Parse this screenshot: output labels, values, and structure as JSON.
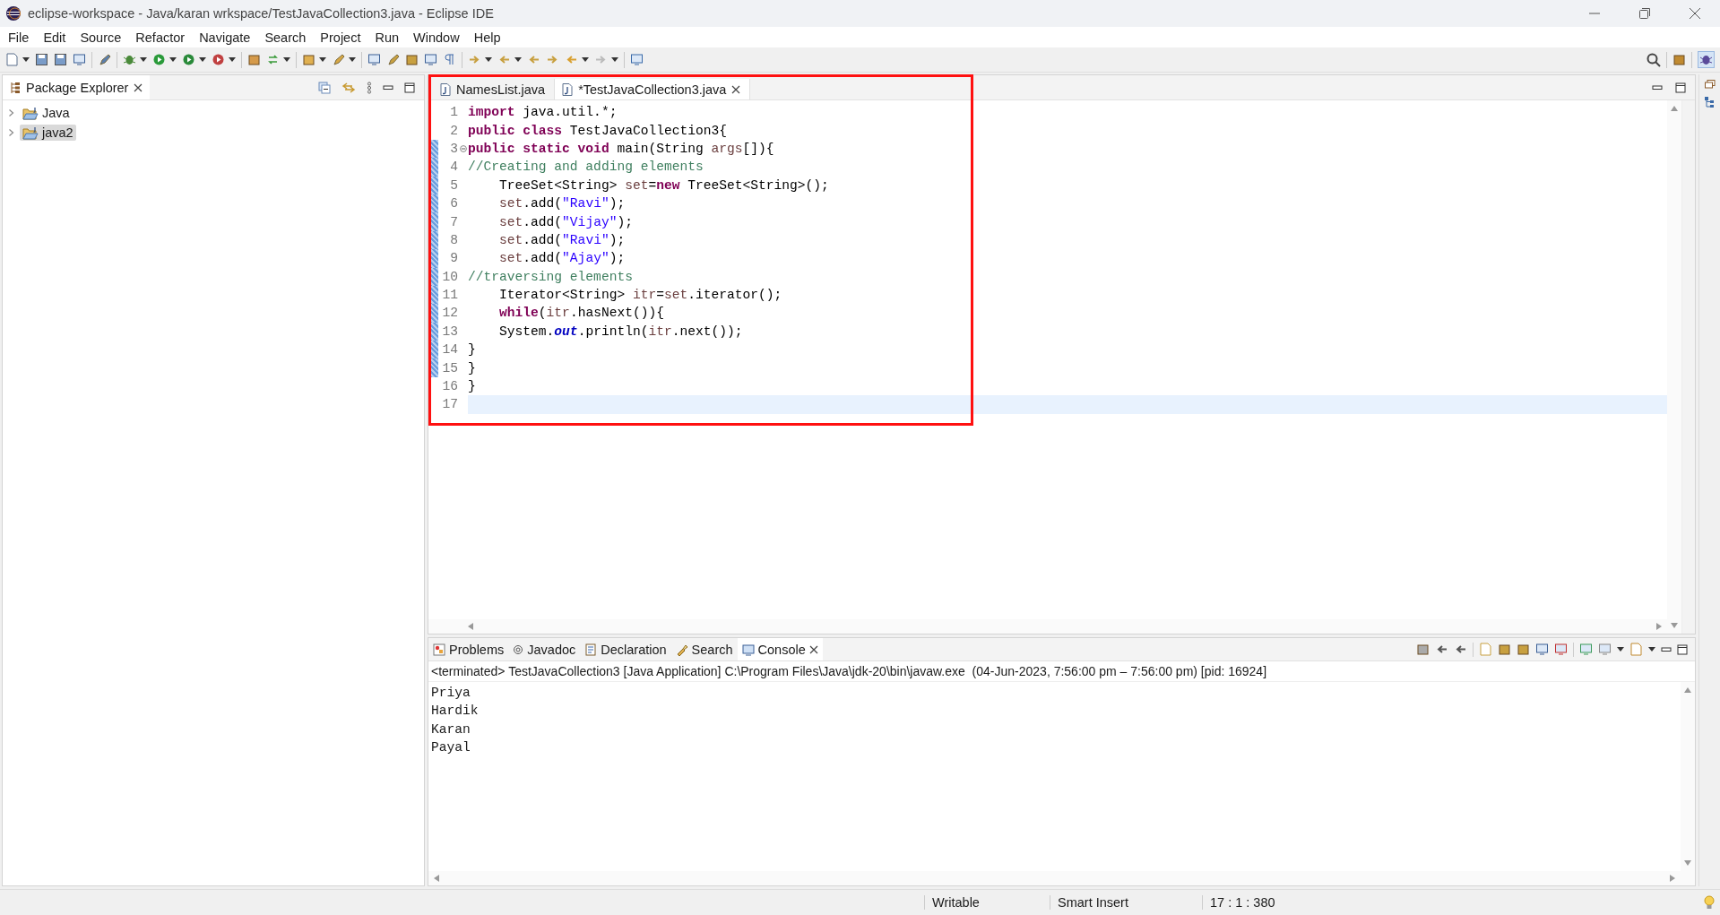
{
  "window": {
    "title": "eclipse-workspace - Java/karan wrkspace/TestJavaCollection3.java - Eclipse IDE"
  },
  "menu": [
    "File",
    "Edit",
    "Source",
    "Refactor",
    "Navigate",
    "Search",
    "Project",
    "Run",
    "Window",
    "Help"
  ],
  "package_explorer": {
    "title": "Package Explorer",
    "projects": [
      {
        "label": "Java",
        "selected": false,
        "expanded": false
      },
      {
        "label": "java2",
        "selected": true,
        "expanded": false
      }
    ]
  },
  "editor": {
    "tabs": [
      {
        "label": "NamesList.java",
        "selected": false
      },
      {
        "label": "*TestJavaCollection3.java",
        "selected": true
      }
    ],
    "lines": [
      {
        "number": "1",
        "changed": false,
        "current": false,
        "foldable": false,
        "segments": [
          {
            "kind": "keyword",
            "text": "import"
          },
          {
            "kind": "plain",
            "text": " java.util.*;"
          }
        ]
      },
      {
        "number": "2",
        "changed": false,
        "current": false,
        "foldable": false,
        "segments": [
          {
            "kind": "keyword",
            "text": "public class"
          },
          {
            "kind": "plain",
            "text": " TestJavaCollection3{"
          }
        ]
      },
      {
        "number": "3",
        "changed": true,
        "current": false,
        "foldable": true,
        "segments": [
          {
            "kind": "keyword",
            "text": "public static void"
          },
          {
            "kind": "plain",
            "text": " main(String "
          },
          {
            "kind": "variable",
            "text": "args"
          },
          {
            "kind": "plain",
            "text": "[]){"
          }
        ]
      },
      {
        "number": "4",
        "changed": true,
        "current": false,
        "foldable": false,
        "segments": [
          {
            "kind": "comment",
            "text": "//Creating and adding elements"
          }
        ]
      },
      {
        "number": "5",
        "changed": true,
        "current": false,
        "foldable": false,
        "segments": [
          {
            "kind": "plain",
            "text": "    TreeSet<String> "
          },
          {
            "kind": "variable",
            "text": "set"
          },
          {
            "kind": "plain",
            "text": "="
          },
          {
            "kind": "keyword",
            "text": "new"
          },
          {
            "kind": "plain",
            "text": " TreeSet<String>();"
          }
        ]
      },
      {
        "number": "6",
        "changed": true,
        "current": false,
        "foldable": false,
        "segments": [
          {
            "kind": "variable",
            "text": "    set"
          },
          {
            "kind": "plain",
            "text": ".add("
          },
          {
            "kind": "string",
            "text": "\"Ravi\""
          },
          {
            "kind": "plain",
            "text": ");"
          }
        ]
      },
      {
        "number": "7",
        "changed": true,
        "current": false,
        "foldable": false,
        "segments": [
          {
            "kind": "variable",
            "text": "    set"
          },
          {
            "kind": "plain",
            "text": ".add("
          },
          {
            "kind": "string",
            "text": "\"Vijay\""
          },
          {
            "kind": "plain",
            "text": ");"
          }
        ]
      },
      {
        "number": "8",
        "changed": true,
        "current": false,
        "foldable": false,
        "segments": [
          {
            "kind": "variable",
            "text": "    set"
          },
          {
            "kind": "plain",
            "text": ".add("
          },
          {
            "kind": "string",
            "text": "\"Ravi\""
          },
          {
            "kind": "plain",
            "text": ");"
          }
        ]
      },
      {
        "number": "9",
        "changed": true,
        "current": false,
        "foldable": false,
        "segments": [
          {
            "kind": "variable",
            "text": "    set"
          },
          {
            "kind": "plain",
            "text": ".add("
          },
          {
            "kind": "string",
            "text": "\"Ajay\""
          },
          {
            "kind": "plain",
            "text": ");"
          }
        ]
      },
      {
        "number": "10",
        "changed": true,
        "current": false,
        "foldable": false,
        "segments": [
          {
            "kind": "comment",
            "text": "//traversing elements"
          }
        ]
      },
      {
        "number": "11",
        "changed": true,
        "current": false,
        "foldable": false,
        "segments": [
          {
            "kind": "plain",
            "text": "    Iterator<String> "
          },
          {
            "kind": "variable",
            "text": "itr"
          },
          {
            "kind": "plain",
            "text": "="
          },
          {
            "kind": "variable",
            "text": "set"
          },
          {
            "kind": "plain",
            "text": ".iterator();"
          }
        ]
      },
      {
        "number": "12",
        "changed": true,
        "current": false,
        "foldable": false,
        "segments": [
          {
            "kind": "keyword",
            "text": "    while"
          },
          {
            "kind": "plain",
            "text": "("
          },
          {
            "kind": "variable",
            "text": "itr"
          },
          {
            "kind": "plain",
            "text": ".hasNext()){"
          }
        ]
      },
      {
        "number": "13",
        "changed": true,
        "current": false,
        "foldable": false,
        "segments": [
          {
            "kind": "plain",
            "text": "    System."
          },
          {
            "kind": "field",
            "text": "out"
          },
          {
            "kind": "plain",
            "text": ".println("
          },
          {
            "kind": "variable",
            "text": "itr"
          },
          {
            "kind": "plain",
            "text": ".next());"
          }
        ]
      },
      {
        "number": "14",
        "changed": true,
        "current": false,
        "foldable": false,
        "segments": [
          {
            "kind": "plain",
            "text": "}"
          }
        ]
      },
      {
        "number": "15",
        "changed": true,
        "current": false,
        "foldable": false,
        "segments": [
          {
            "kind": "plain",
            "text": "}"
          }
        ]
      },
      {
        "number": "16",
        "changed": false,
        "current": false,
        "foldable": false,
        "segments": [
          {
            "kind": "plain",
            "text": "}"
          }
        ]
      },
      {
        "number": "17",
        "changed": false,
        "current": true,
        "foldable": false
      }
    ]
  },
  "bottom_panel": {
    "tabs": [
      {
        "label": "Problems",
        "selected": false
      },
      {
        "label": "Javadoc",
        "selected": false
      },
      {
        "label": "Declaration",
        "selected": false
      },
      {
        "label": "Search",
        "selected": false
      },
      {
        "label": "Console",
        "selected": true
      }
    ],
    "status": "<terminated> TestJavaCollection3 [Java Application] C:\\Program Files\\Java\\jdk-20\\bin\\javaw.exe  (04-Jun-2023, 7:56:00 pm – 7:56:00 pm) [pid: 16924]",
    "output": [
      "Priya",
      "Hardik",
      "Karan",
      "Payal"
    ]
  },
  "status_bar": [
    "Writable",
    "Smart Insert",
    "17 : 1 : 380"
  ]
}
